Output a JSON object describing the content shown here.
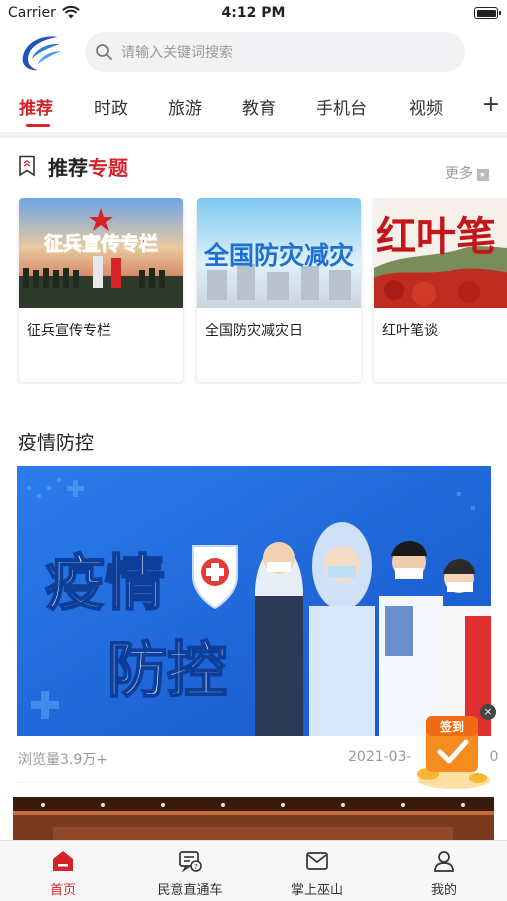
{
  "status_bar": {
    "carrier": "Carrier",
    "time": "4:12 PM"
  },
  "search": {
    "placeholder": "请输入关键词搜索"
  },
  "tabs": [
    {
      "label": "推荐",
      "active": true
    },
    {
      "label": "时政"
    },
    {
      "label": "旅游"
    },
    {
      "label": "教育"
    },
    {
      "label": "手机台"
    },
    {
      "label": "视频"
    }
  ],
  "tab_add": "+",
  "topics": {
    "title_part1": "推荐",
    "title_part2": "专题",
    "more": "更多",
    "more_arrow": "▸",
    "cards": [
      {
        "caption": "征兵宣传专栏",
        "image_text": "征兵宣传专栏"
      },
      {
        "caption": "全国防灾减灾日",
        "image_text": "全国防灾减灾"
      },
      {
        "caption": "红叶笔谈",
        "image_text": "红叶笔"
      }
    ]
  },
  "epidemic": {
    "section_title": "疫情防控",
    "banner_line1": "疫情",
    "banner_line2": "防控",
    "views": "浏览量3.9万+",
    "date": "2021-03-",
    "date_tail": "0"
  },
  "float_sign": {
    "label": "签到",
    "close": "×"
  },
  "bottom_nav": [
    {
      "label": "首页",
      "icon": "home-icon",
      "active": true
    },
    {
      "label": "民意直通车",
      "icon": "message-icon"
    },
    {
      "label": "掌上巫山",
      "icon": "mail-icon"
    },
    {
      "label": "我的",
      "icon": "user-icon"
    }
  ],
  "colors": {
    "accent": "#d4242a",
    "banner_bg": "#1f6ee0"
  }
}
